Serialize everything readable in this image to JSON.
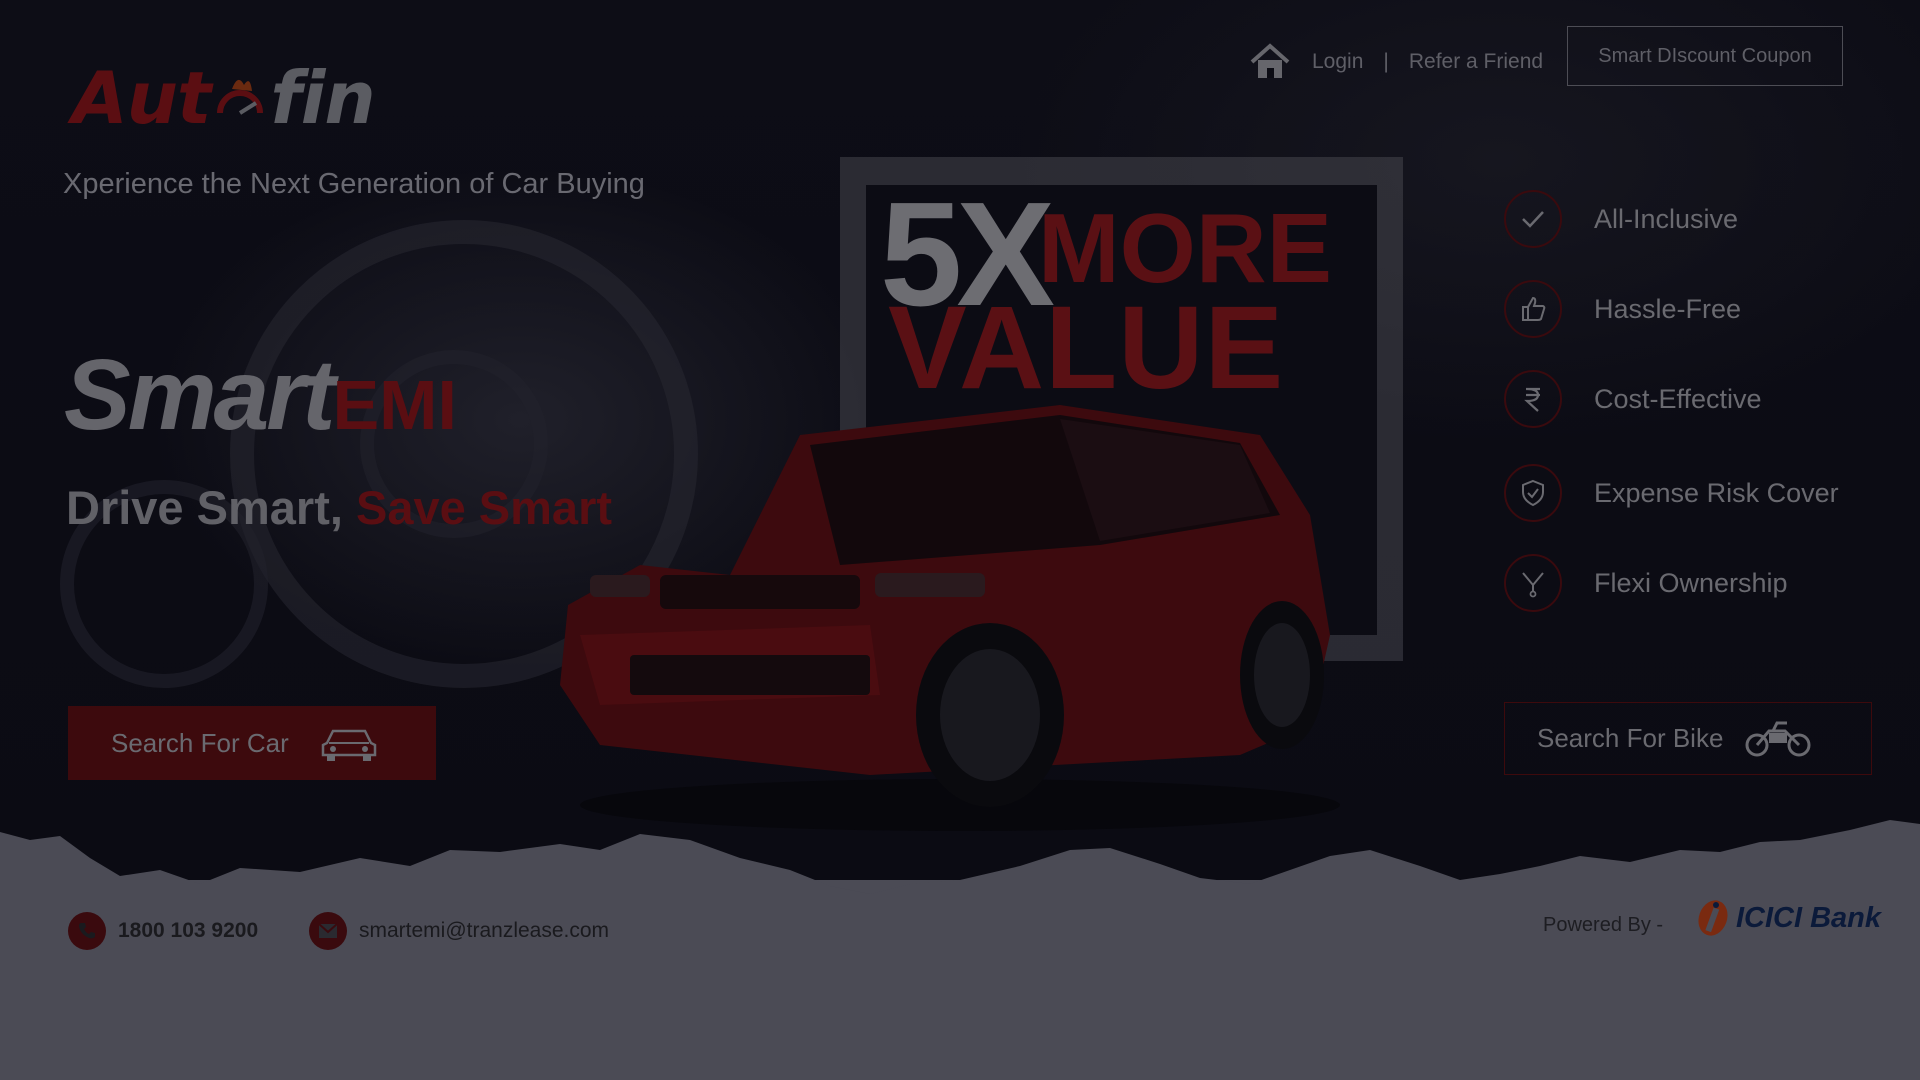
{
  "brand": {
    "logo_part1": "Aut",
    "logo_part2": "fin",
    "tagline": "Xperience the Next Generation of Car Buying"
  },
  "nav": {
    "login": "Login",
    "separator": "|",
    "refer": "Refer a Friend",
    "coupon": "Smart DIscount Coupon"
  },
  "hero": {
    "title_main": "Smart",
    "title_accent": "EMI",
    "subtitle_white": "Drive Smart,",
    "subtitle_red": "Save Smart",
    "promo_multiplier": "5X",
    "promo_more": "MORE",
    "promo_value": "VALUE"
  },
  "features": [
    {
      "label": "All-Inclusive",
      "icon": "check-icon"
    },
    {
      "label": "Hassle-Free",
      "icon": "thumbs-up-icon"
    },
    {
      "label": "Cost-Effective",
      "icon": "rupee-icon"
    },
    {
      "label": "Expense Risk Cover",
      "icon": "shield-icon"
    },
    {
      "label": "Flexi Ownership",
      "icon": "branch-icon"
    }
  ],
  "actions": {
    "search_car": "Search For Car",
    "search_bike": "Search For Bike"
  },
  "footer": {
    "phone": "1800 103 9200",
    "email": "smartemi@tranzlease.com",
    "powered_by": "Powered By -",
    "bank_name": "ICICI Bank"
  },
  "colors": {
    "accent_red": "#5a0e12",
    "bank_orange": "#7a2a10",
    "bank_blue": "#0b1a3a"
  }
}
